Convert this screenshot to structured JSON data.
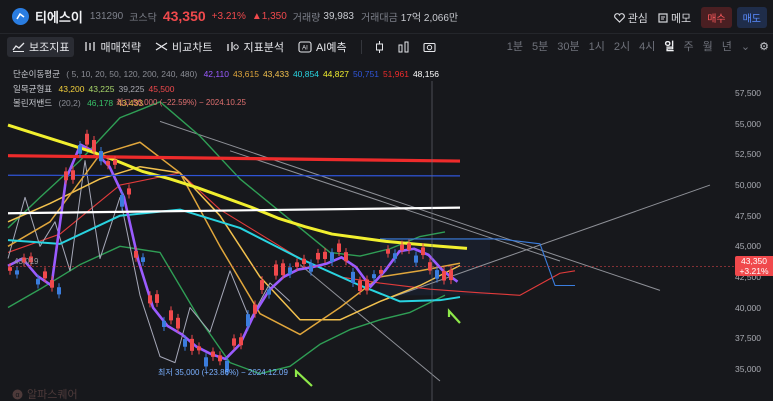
{
  "header": {
    "name": "티에스이",
    "code": "131290",
    "market": "코스닥",
    "price": "43,350",
    "change_pct": "+3.21%",
    "change_abs": "▲1,350",
    "volume_label": "거래량",
    "volume": "39,983",
    "value_label": "거래대금",
    "value": "17억 2,066만",
    "watch_label": "관심",
    "memo_label": "메모",
    "buy_label": "매수",
    "sell_label": "매도"
  },
  "toolbar": {
    "indicators": "보조지표",
    "strategy": "매매전략",
    "compare": "비교차트",
    "index_analysis": "지표분석",
    "ai_predict": "AI예측",
    "timeframes": [
      "1분",
      "5분",
      "30분",
      "1시",
      "2시",
      "4시",
      "일",
      "주",
      "월",
      "년"
    ],
    "active_timeframe": "일"
  },
  "legend": {
    "ma": {
      "title": "단순이동평균",
      "params": "( 5, 10, 20, 50, 120, 200, 240, 480)",
      "values": [
        "42,110",
        "43,615",
        "43,433",
        "40,854",
        "44,827",
        "50,751",
        "51,961",
        "48,156"
      ],
      "colors": [
        "#9a5bff",
        "#e0a63c",
        "#f2c14e",
        "#29d3e0",
        "#f1ef2f",
        "#2f54d6",
        "#ee2b2b",
        "#ffffff"
      ]
    },
    "ichimoku": {
      "title": "일목균형표",
      "values": [
        "43,200",
        "43,225",
        "39,225",
        "45,500"
      ],
      "colors": [
        "#f2d03c",
        "#a8d66a",
        "#a8a8b0",
        "#f0494c"
      ]
    },
    "bollinger": {
      "title": "볼린저밴드",
      "params": "(20,2)",
      "values": [
        "46,178",
        "43,433"
      ],
      "colors": [
        "#38c067",
        "#f2c14e"
      ]
    }
  },
  "annotations": {
    "high": "최고 56,000 (−22.59%) − 2024.10.25",
    "low": "최저 35,000 (+23.86%) − 2024.12.09",
    "left_price": "43,019"
  },
  "y_axis": {
    "ticks": [
      "57,500",
      "55,000",
      "52,500",
      "50,000",
      "47,500",
      "45,000",
      "42,500",
      "40,000",
      "37,500",
      "35,000"
    ],
    "current": "43,350",
    "current_pct": "+3.21%"
  },
  "watermark": "알파스퀘어",
  "colors": {
    "up": "#f0494c",
    "down": "#3b7ddd",
    "bg": "#17181c"
  },
  "chart_data": {
    "type": "line",
    "series": [
      {
        "name": "단순이동평균 5",
        "values": [
          43400,
          44000,
          42600,
          41800,
          50500,
          53300,
          52700,
          51500,
          49000,
          43800,
          40000,
          38500,
          37800,
          36800,
          36200,
          35800,
          37000,
          39500,
          41400,
          42500,
          43100,
          43300,
          43600,
          44100,
          43300,
          41700,
          43000,
          44600,
          44800,
          44300,
          43000,
          42110
        ]
      },
      {
        "name": "단순이동평균 120",
        "values": [
          54900,
          54200,
          53500,
          52800,
          52000,
          51100,
          50500,
          49800,
          49000,
          48200,
          47300,
          46600,
          46000,
          45700,
          45400,
          45200,
          45000,
          44827
        ]
      },
      {
        "name": "단순이동평균 240",
        "values": [
          52300,
          52300,
          52250,
          52200,
          52150,
          52050,
          52000,
          51961
        ]
      },
      {
        "name": "단순이동평균 480",
        "values": [
          47700,
          47800,
          47850,
          47900,
          47950,
          48000,
          48100,
          48156
        ]
      }
    ],
    "ylim": [
      34000,
      58500
    ]
  }
}
